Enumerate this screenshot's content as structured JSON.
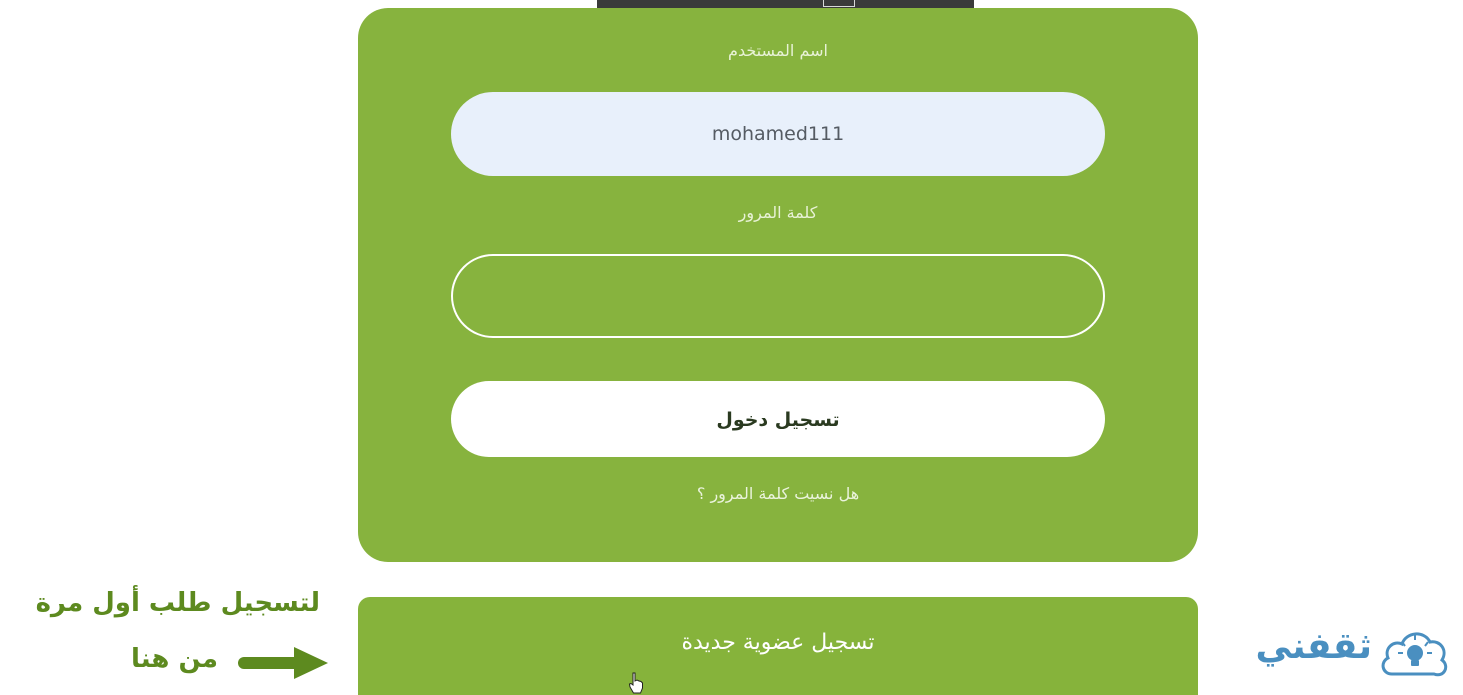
{
  "login_form": {
    "username_label": "اسم المستخدم",
    "username_value": "mohamed111",
    "password_label": "كلمة المرور",
    "password_value": "",
    "login_button_label": "تسجيل دخول",
    "forgot_password_link": "هل نسيت كلمة المرور ؟"
  },
  "register": {
    "button_label": "تسجيل عضوية جديدة"
  },
  "annotation": {
    "line1": "لتسجيل طلب أول مرة",
    "line2": "من هنا"
  },
  "brand": {
    "name": "ثقفني",
    "icon": "lightbulb-cloud-icon"
  },
  "colors": {
    "card_green": "#87b33e",
    "annotation_green": "#5d8a1f",
    "brand_blue": "#4a8fc0",
    "input_fill": "#e8f0fb"
  }
}
